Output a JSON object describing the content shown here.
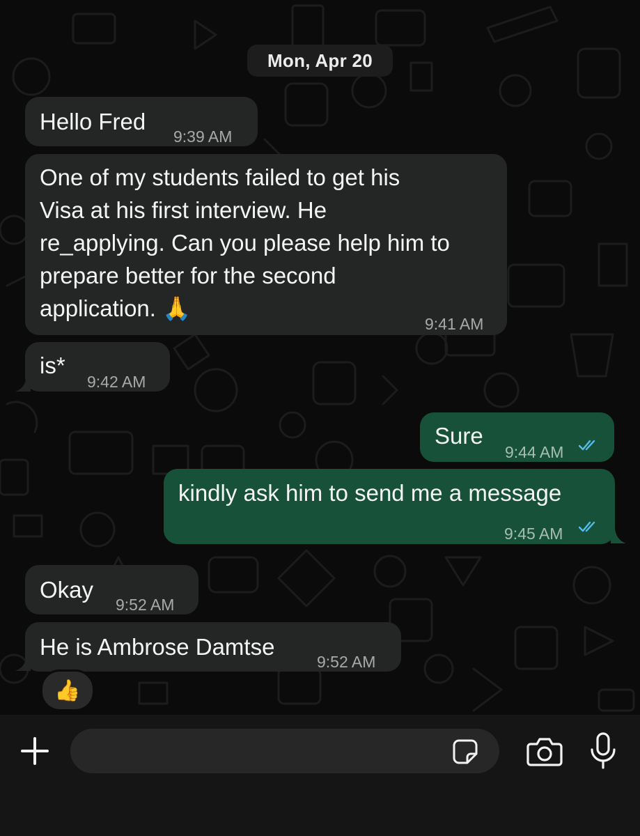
{
  "chat": {
    "date_divider": "Mon, Apr 20",
    "messages": [
      {
        "direction": "in",
        "lines": [
          "Hello Fred"
        ],
        "time": "9:39 AM"
      },
      {
        "direction": "in",
        "lines": [
          "One of my students failed to get his",
          "Visa at his first interview. He",
          "re_applying. Can you please help him to",
          "prepare better for the second",
          "application. 🙏"
        ],
        "time": "9:41 AM"
      },
      {
        "direction": "in",
        "lines": [
          "is*"
        ],
        "time": "9:42 AM"
      },
      {
        "direction": "out",
        "lines": [
          "Sure"
        ],
        "time": "9:44 AM",
        "status": "read"
      },
      {
        "direction": "out",
        "lines": [
          "kindly ask him to send me a message"
        ],
        "time": "9:45 AM",
        "status": "read"
      },
      {
        "direction": "in",
        "lines": [
          "Okay"
        ],
        "time": "9:52 AM"
      },
      {
        "direction": "in",
        "lines": [
          "He is Ambrose Damtse"
        ],
        "time": "9:52 AM"
      }
    ],
    "reaction": "👍"
  },
  "composer": {
    "input_value": "",
    "icons": {
      "add": "plus-icon",
      "sticker": "sticker-icon",
      "camera": "camera-icon",
      "mic": "microphone-icon"
    }
  },
  "colors": {
    "background": "#0b0b0b",
    "incoming_bubble": "#242626",
    "outgoing_bubble": "#17513a",
    "read_ticks": "#53bdeb"
  }
}
